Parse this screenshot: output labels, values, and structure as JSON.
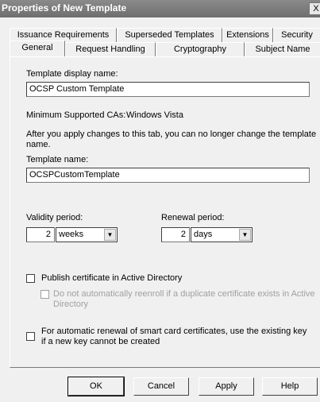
{
  "window": {
    "title": "Properties of New Template",
    "close_glyph": "X"
  },
  "tabs_row1": [
    "Issuance Requirements",
    "Superseded Templates",
    "Extensions",
    "Security"
  ],
  "tabs_row2": [
    "General",
    "Request Handling",
    "Cryptography",
    "Subject Name"
  ],
  "active_tab": "General",
  "general": {
    "display_name_label": "Template display name:",
    "display_name_value": "OCSP Custom Template",
    "min_ca_label": "Minimum Supported CAs:",
    "min_ca_value": "Windows Vista",
    "warning_line1": "After you apply changes to this tab, you can no longer change the template",
    "warning_line2": "name.",
    "template_name_label": "Template name:",
    "template_name_value": "OCSPCustomTemplate",
    "validity_label": "Validity period:",
    "validity_value": "2",
    "validity_unit": "weeks",
    "renewal_label": "Renewal period:",
    "renewal_value": "2",
    "renewal_unit": "days",
    "publish_label": "Publish certificate in Active Directory",
    "publish_checked": false,
    "no_reenroll_line1": "Do not automatically reenroll if a duplicate certificate exists in Active",
    "no_reenroll_line2": "Directory",
    "no_reenroll_checked": false,
    "smartcard_line1": "For automatic renewal of smart card certificates, use the existing key",
    "smartcard_line2": "if a new key cannot be created",
    "smartcard_checked": false
  },
  "buttons": {
    "ok": "OK",
    "cancel": "Cancel",
    "apply": "Apply",
    "help": "Help"
  }
}
